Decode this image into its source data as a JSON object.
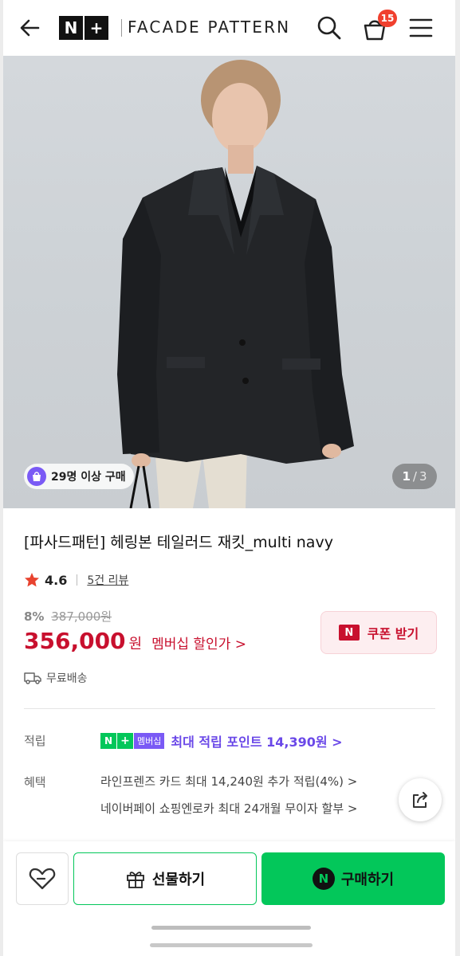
{
  "header": {
    "brand_logo": [
      "N",
      "+"
    ],
    "brand_name": "FACADE PATTERN",
    "cart_count": "15"
  },
  "gallery": {
    "purchase_badge": "29명 이상 구매",
    "current": "1",
    "separator": "/",
    "total": "3"
  },
  "product": {
    "title": "[파사드패턴] 헤링본 테일러드 재킷_multi navy",
    "rating": "4.6",
    "review_link": "5건 리뷰",
    "discount_rate": "8%",
    "original_price": "387,000원",
    "price": "356,000",
    "currency": "원",
    "member_price_link": "멤버십 할인가 >",
    "coupon": {
      "badge": "N",
      "label": "쿠폰 받기"
    },
    "shipping": "무료배송"
  },
  "points": {
    "label": "적립",
    "np_badge": [
      "N",
      "+"
    ],
    "membership_tag": "멤버십",
    "text": "최대 적립 포인트 14,390원 >"
  },
  "benefits": {
    "label": "혜택",
    "line1": "라인프렌즈 카드 최대 14,240원 추가 적립(4%) >",
    "line2": "네이버페이 쇼핑엔로카 최대 24개월 무이자 할부 >"
  },
  "bottom_bar": {
    "gift_label": "선물하기",
    "buy_badge": "N",
    "buy_label": "구매하기"
  },
  "colors": {
    "price_red": "#c8102e",
    "naver_green": "#03c75a",
    "membership_purple": "#7a5af5",
    "cart_badge": "#f0402e"
  },
  "icons": [
    "back-arrow-icon",
    "search-icon",
    "cart-icon",
    "menu-icon",
    "shopping-bag-icon",
    "star-icon",
    "truck-icon",
    "share-icon",
    "heart-icon",
    "gift-icon"
  ]
}
